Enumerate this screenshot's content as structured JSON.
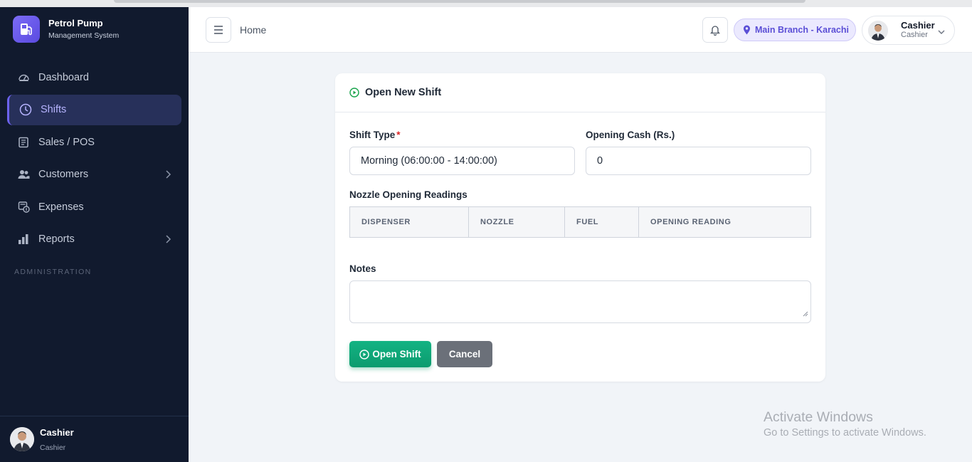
{
  "brand": {
    "title": "Petrol Pump",
    "subtitle": "Management System"
  },
  "sidebar": {
    "items": [
      {
        "label": "Dashboard",
        "icon": "gauge-icon"
      },
      {
        "label": "Shifts",
        "icon": "clock-icon",
        "active": true
      },
      {
        "label": "Sales / POS",
        "icon": "receipt-icon"
      },
      {
        "label": "Customers",
        "icon": "users-icon",
        "has_children": true
      },
      {
        "label": "Expenses",
        "icon": "expense-icon"
      },
      {
        "label": "Reports",
        "icon": "bar-chart-icon",
        "has_children": true
      }
    ],
    "section_label": "ADMINISTRATION",
    "footer": {
      "name": "Cashier",
      "role": "Cashier"
    }
  },
  "header": {
    "breadcrumb": "Home",
    "branch": "Main Branch - Karachi",
    "user": {
      "name": "Cashier",
      "role": "Cashier"
    }
  },
  "form": {
    "title": "Open New Shift",
    "shift_type": {
      "label": "Shift Type",
      "required_mark": "*",
      "value": "Morning (06:00:00 - 14:00:00)"
    },
    "opening_cash": {
      "label": "Opening Cash (Rs.)",
      "value": "0"
    },
    "nozzle_readings": {
      "label": "Nozzle Opening Readings",
      "columns": [
        "DISPENSER",
        "NOZZLE",
        "FUEL",
        "OPENING READING"
      ]
    },
    "notes": {
      "label": "Notes",
      "value": ""
    },
    "buttons": {
      "open": "Open Shift",
      "cancel": "Cancel"
    }
  },
  "watermark": {
    "title": "Activate Windows",
    "subtitle": "Go to Settings to activate Windows."
  },
  "colors": {
    "sidebar_bg": "#111a2e",
    "accent": "#6c62ee",
    "success": "#10a675",
    "cancel": "#6b7079"
  }
}
